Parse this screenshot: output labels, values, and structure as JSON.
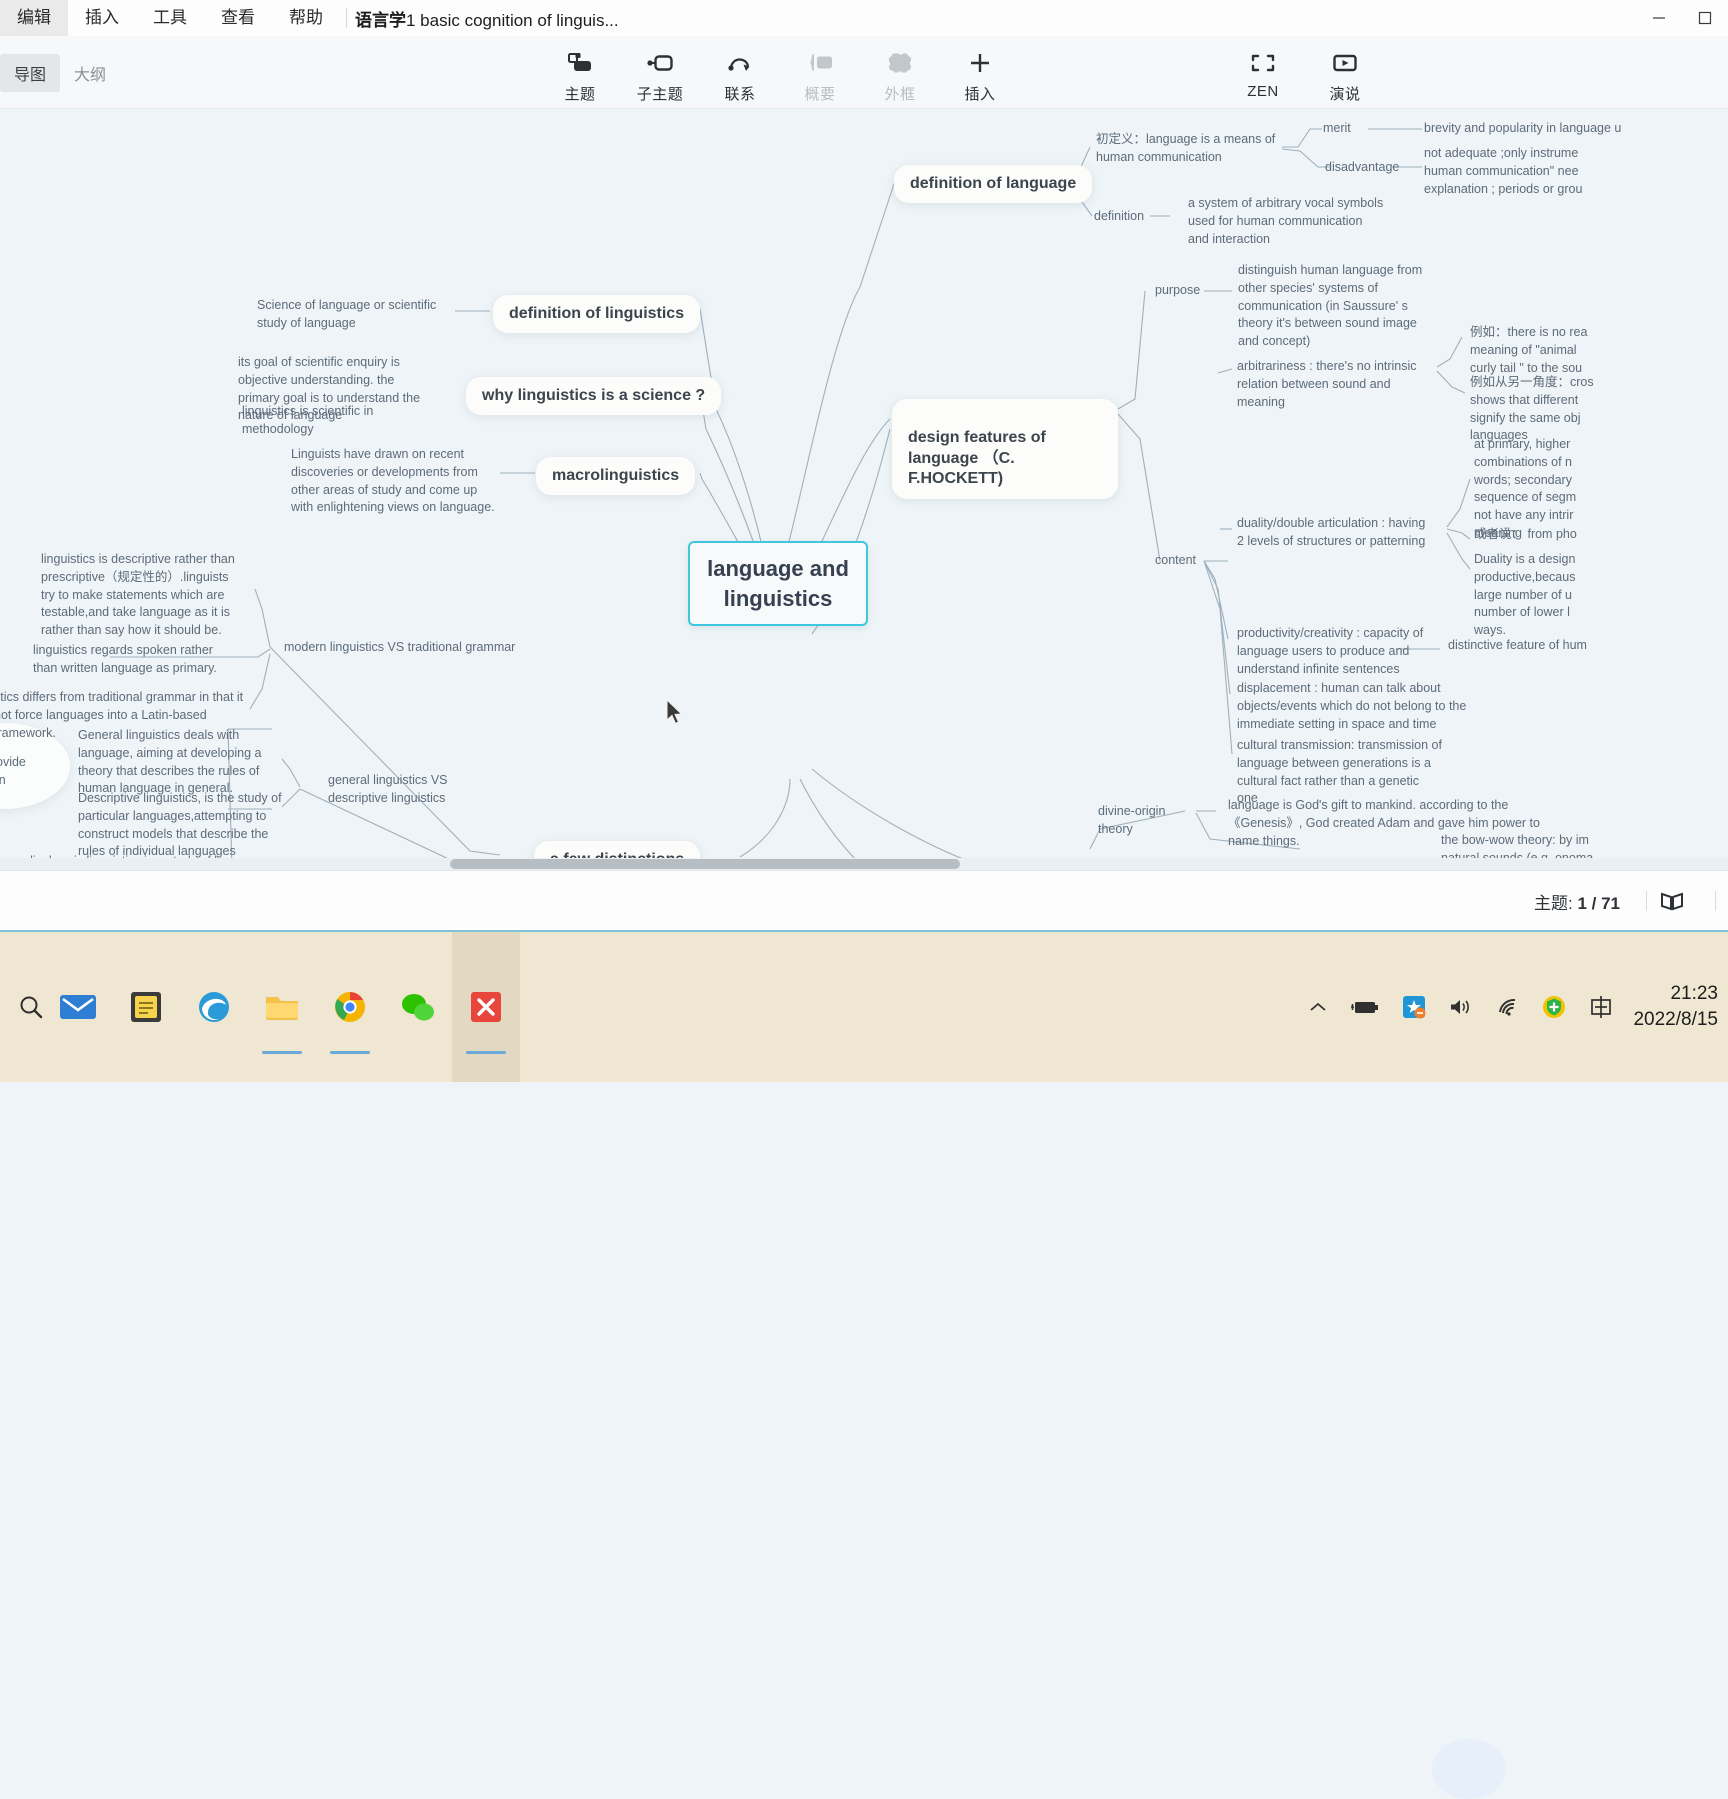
{
  "window": {
    "menus": [
      "编辑",
      "插入",
      "工具",
      "查看",
      "帮助"
    ],
    "doc_title_bold": "语言学",
    "doc_title_rest": "1 basic cognition of linguis...",
    "minimize_label": "minimize",
    "maximize_label": "maximize"
  },
  "toolbar": {
    "view_tabs": [
      {
        "label": "导图",
        "active": true
      },
      {
        "label": "大纲",
        "active": false
      }
    ],
    "tools": [
      {
        "label": "主题",
        "icon": "topic-icon",
        "disabled": false
      },
      {
        "label": "子主题",
        "icon": "subtopic-icon",
        "disabled": false
      },
      {
        "label": "联系",
        "icon": "relation-icon",
        "disabled": false
      },
      {
        "label": "概要",
        "icon": "summary-icon",
        "disabled": true
      },
      {
        "label": "外框",
        "icon": "boundary-icon",
        "disabled": true
      },
      {
        "label": "插入",
        "icon": "plus-icon",
        "disabled": false
      }
    ],
    "tools_right": [
      {
        "label": "ZEN",
        "icon": "zen-fullscreen-icon",
        "disabled": false
      },
      {
        "label": "演说",
        "icon": "presentation-play-icon",
        "disabled": false
      }
    ]
  },
  "mindmap": {
    "root": "language and linguistics",
    "branches": {
      "definition_of_language": "definition of language",
      "definition_of_linguistics": "definition of linguistics",
      "why_linguistics_is_a_science": "why linguistics is a science ?",
      "macrolinguistics": "macrolinguistics",
      "design_features": "design features of language （C. F.HOCKETT)",
      "a_few_distinctions": "a few distinctions"
    },
    "nodes": {
      "chudingyi": "初定义：language is a means of human communication",
      "merit": "merit",
      "merit_detail": "brevity and popularity in language u",
      "disadvantage": "disadvantage",
      "disadvantage_detail": "not adequate ;only instrume\nhuman communication\" nee\nexplanation ; periods or grou",
      "definition": "definition",
      "definition_detail": "a system of arbitrary vocal symbols used for human communication and interaction",
      "science_of_language": "Science of language or scientific study of language",
      "goal_of_enquiry": "its goal of scientific enquiry is objective understanding. the primary goal is to understand the nature of language",
      "scientific_methodology": "linguistics is scientific in methodology",
      "macro_detail": "Linguists have drawn on recent discoveries or developments from other areas of study and come up with enlightening views on language.",
      "purpose": "purpose",
      "purpose_detail": "distinguish human language from other species' systems of communication (in Saussure' s theory it's between sound image and concept)",
      "arbitrariness": "arbitrariness : there's no intrinsic relation between sound and meaning",
      "arb_eg1": "例如：there is no rea\nmeaning of \"animal\ncurly tail \" to the sou",
      "arb_eg2": "例如从另一角度：cros\nshows that different\nsignify the same obj\nlanguages",
      "content": "content",
      "duality": "duality/double articulation : having 2 levels of structures or patterning",
      "duality_detail1": "at primary, higher\ncombinations of n\nwords; secondary\nsequence of segm\nnot have any intrir\nmeaning",
      "duality_detail2": "或者说： from pho",
      "duality_detail3": "Duality is a design\nproductive,becaus\nlarge number of u\nnumber of lower l\nways.",
      "productivity": "productivity/creativity : capacity of language users to produce and understand  infinite sentences",
      "productivity_detail": "distinctive feature of hum",
      "displacement": "displacement : human can talk about objects/events which do not belong to the immediate setting in space and time",
      "cultural_transmission": "cultural transmission: transmission of language between generations is a cultural fact rather than a genetic one",
      "descriptive_not_prescriptive": "linguistics is descriptive rather than prescriptive（规定性的）.linguists try to make statements which are testable,and take language as it is rather than say how it should be.",
      "spoken_primary": "linguistics regards spoken rather than written language as primary.",
      "latin_framework": "stics differs from traditional grammar in that it\nnot force languages into a Latin-based framework.",
      "modern_vs_traditional": "modern linguistics  VS traditional grammar",
      "general_linguistics": "General linguistics deals with language, aiming at developing a theory that describes the rules of human language in general.",
      "descriptive_linguistics": "Descriptive linguistics, is the study of particular languages,attempting to construct models that describe the rules of individual languages",
      "general_vs_descriptive": "general linguistics  VS descriptive linguistics",
      "diachronic": "diachronic linguistics is a study of language change",
      "blob_text": "ovide\nin",
      "divine_origin": "divine-origin theory",
      "divine_detail": "language is God's gift to mankind. according to the《Genesis》, God created Adam and gave him power to name things.",
      "bow_wow": "the bow-wow theory: by im\nnatural sounds (e.g. onoma"
    }
  },
  "statusbar": {
    "topic_label": "主题:",
    "topic_count": "1 / 71",
    "map_icon": "map-book-icon"
  },
  "taskbar": {
    "start_icon": "windows-search-icon",
    "apps": [
      {
        "name": "mail-app-icon",
        "active": false
      },
      {
        "name": "sticky-notes-app-icon",
        "active": false
      },
      {
        "name": "edge-browser-icon",
        "active": false
      },
      {
        "name": "file-explorer-icon",
        "active": false
      },
      {
        "name": "chrome-browser-icon",
        "active": false
      },
      {
        "name": "wechat-app-icon",
        "active": false
      },
      {
        "name": "xmind-app-icon",
        "active": true
      }
    ],
    "tray": [
      "chevron-up-icon",
      "battery-charging-icon",
      "action-center-icon",
      "volume-icon",
      "wifi-icon",
      "security-shield-icon",
      "ime-chinese-icon"
    ],
    "time": "21:23",
    "date": "2022/8/15"
  },
  "colors": {
    "canvas_bg": "#eef4f7",
    "root_border": "#3ec8de",
    "taskbar_bg": "#f0e7d2",
    "accent_line": "#7fc4d6"
  }
}
